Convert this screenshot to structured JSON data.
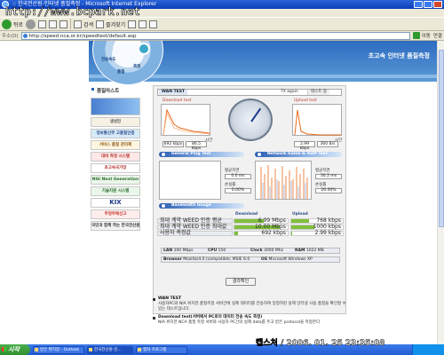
{
  "browser": {
    "title": ":: 한국전산원-인터넷 품질측정 - Microsoft Internet Explorer",
    "watermark": "http://www.bcpark.net",
    "toolbar": {
      "back": "뒤로",
      "search": "검색",
      "favorites": "즐겨찾기"
    },
    "address_label": "주소(D)",
    "address": "http://speed.nca.or.kr/speedtest/default.asp",
    "go": "이동",
    "links": "연결"
  },
  "banner": {
    "title": "초고속 인터넷 품질측정",
    "globe_labels": [
      "전송속도",
      "품질",
      "측정"
    ]
  },
  "leftnav": {
    "title": "품질마스트",
    "items": [
      "",
      "생성만",
      "정보통신부 고품질인증",
      "서비스 품질 관리제",
      "대비 측정 시스템",
      "초고속국가망",
      "NGI Next Generation",
      "기술지원 시스템",
      "KIX",
      "부정부패신고",
      "국민과 함께 하는 한국전산원"
    ]
  },
  "panel": {
    "tabs": [
      "WAN TEST",
      "TX again",
      "테스트 중"
    ],
    "download": {
      "label": "Download test",
      "caption": "시간",
      "max": "692 kbps",
      "avg": "86.5 kbps"
    },
    "upload": {
      "label": "Upload test",
      "caption": "시간",
      "max": "2.99 kbps",
      "avg": "360 B/s"
    },
    "general_ping": "General Ping Test",
    "network_game": "Network Game & VoIP Test",
    "bandwidth": "Bandwidth Gauge",
    "ping_side": {
      "l1": "평균지연",
      "v1": "0.0 ms",
      "l2": "손실률",
      "v2": "0.00%"
    },
    "game_side": {
      "l1": "평균지연",
      "v1": "30.2 ms",
      "l2": "손실률",
      "v2": "26.00%"
    },
    "results": {
      "head_download": "Download",
      "head_upload": "Upload",
      "rows": [
        {
          "label": "최대 계약 WEED 인증 평균",
          "dl": "6.99 Mbps",
          "ul": "768 kbps",
          "dl_fill": 0.55,
          "ul_fill": 0.35
        },
        {
          "label": "최대 계약 WEED 인증 최대값",
          "dl": "10.00 Mbps",
          "ul": "1000 kbps",
          "dl_fill": 0.85,
          "ul_fill": 0.45
        },
        {
          "label": "사용자 측정값",
          "dl": "692 kbps",
          "ul": "2.99 kbps",
          "dl_fill": 0.06,
          "ul_fill": 0.02
        }
      ]
    },
    "info": {
      "lan_label": "LAN",
      "lan": "100 Mbps",
      "cpu_label": "CPU",
      "cpu": "550",
      "clock_label": "Clock",
      "clock": "3000 Mhz",
      "ram_label": "RAM",
      "ram": "1022 MB",
      "browser_label": "Browser",
      "browser": "Mozilla/4.0 (compatible; MSIE 6.0",
      "os_label": "OS",
      "os": "Microsoft Windows XP"
    },
    "confirm": "결과확인"
  },
  "notes": [
    {
      "title": "WAN TEST",
      "text": "사용자PC와 NIA 위치한 품질측정 서버간에 실제 데이터를 전송하여 일정하된 실제 인터넷 사용 품질을 확인할 수 있는 테스트입니다."
    },
    {
      "title": "Download test(서버에서 PC로의 데이터 전송 속도 측정)",
      "text": "NIA 위치한 NCA 품질 측정 서버와 사용자 PC간의 실제 data를 주고 받은 protocol을 측정한다"
    }
  ],
  "timestamp": "캡스처 / 2006. 01. 25 23:35:08",
  "taskbar": {
    "start": "시작",
    "tasks": [
      "받은 편지함 - Outlook",
      "한국전산원-인...",
      "캡처 프로그램"
    ]
  },
  "colors": {
    "title_blue": "#0a3fb8",
    "banner_blue": "#2c6bc0",
    "bar_green": "#7fbf3a",
    "chart_orange": "#e86a1a"
  }
}
